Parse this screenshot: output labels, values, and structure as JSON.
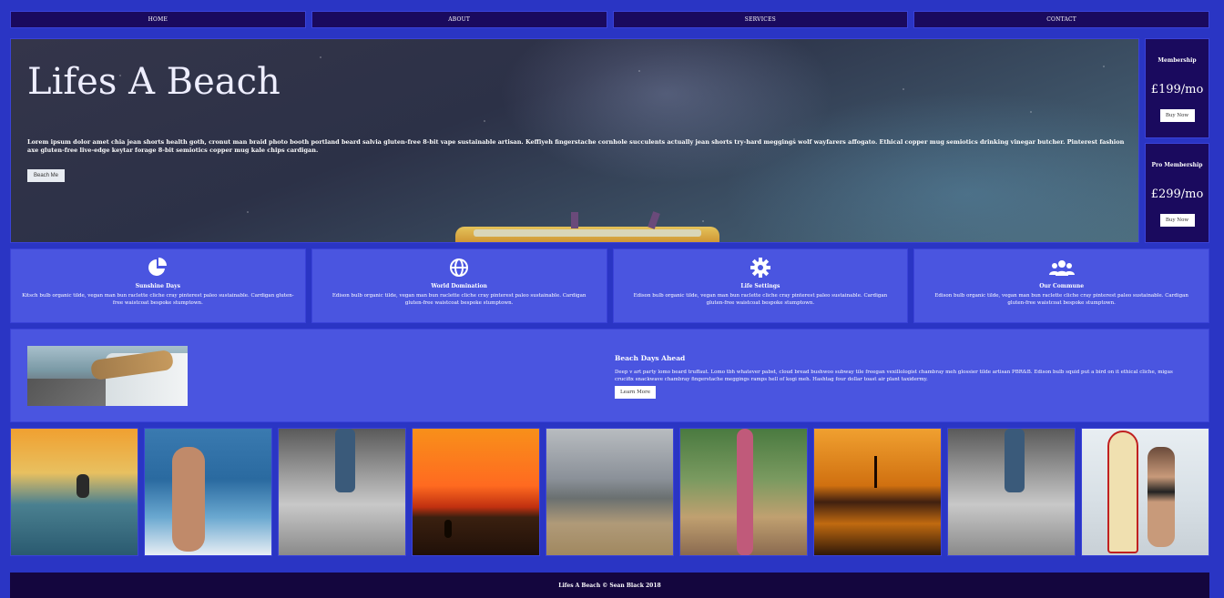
{
  "nav": {
    "items": [
      "HOME",
      "ABOUT",
      "SERVICES",
      "CONTACT"
    ]
  },
  "hero": {
    "title": "Lifes A Beach",
    "text": "Lorem ipsum dolor amet chia jean shorts health goth, cronut man braid photo booth portland beard salvia gluten-free 8-bit vape sustainable artisan. Keffiyeh fingerstache cornhole succulents actually jean shorts try-hard meggings wolf wayfarers affogato. Ethical copper mug semiotics drinking vinegar butcher. Pinterest fashion axe gluten-free live-edge keytar forage 8-bit semiotics copper mug kale chips cardigan.",
    "button": "Beach Me"
  },
  "plans": [
    {
      "title": "Membership",
      "price": "£199/mo",
      "button": "Buy Now"
    },
    {
      "title": "Pro Membership",
      "price": "£299/mo",
      "button": "Buy Now"
    }
  ],
  "features": [
    {
      "icon": "pie-chart-icon",
      "title": "Sunshine Days",
      "text": "Kitsch bulb organic tilde, vegan man bun raclette cliche cray pinterest paleo sustainable. Cardigan gluten-free waistcoat bespoke stumptown."
    },
    {
      "icon": "globe-icon",
      "title": "World Domination",
      "text": "Edison bulb organic tilde, vegan man bun raclette cliche cray pinterest paleo sustainable. Cardigan gluten-free waistcoat bespoke stumptown."
    },
    {
      "icon": "gear-icon",
      "title": "Life Settings",
      "text": "Edison bulb organic tilde, vegan man bun raclette cliche cray pinterest paleo sustainable. Cardigan gluten-free waistcoat bespoke stumptown."
    },
    {
      "icon": "users-icon",
      "title": "Our Commune",
      "text": "Edison bulb organic tilde, vegan man bun raclette cliche cray pinterest paleo sustainable. Cardigan gluten-free waistcoat bespoke stumptown."
    }
  ],
  "promo": {
    "title": "Beach Days Ahead",
    "text": "Deep v art party lomo beard truffaut. Lomo tbh whatever pabst, cloud bread bushwoo subway tile freegan vexillologist chambray meh glossier tilde artisan PBR&B. Edison bulb squid put a bird on it ethical cliche, migas crucifix snackwave chambray fingerstache meggings ramps hell of kogi meh. Hashtag four dollar toast air plant taxidermy.",
    "button": "Learn More"
  },
  "gallery": [
    "surfer-sunset-photo",
    "bikini-waves-photo",
    "beach-walker-photo",
    "orange-sunset-photo",
    "cloudy-beach-photo",
    "friends-surfboard-photo",
    "palm-sunset-photo",
    "beach-walker-photo",
    "surfboard-woman-photo"
  ],
  "footer": {
    "text": "Lifes A Beach © Sean Black 2018"
  },
  "colors": {
    "background": "#2a35c4",
    "nav": "#1a0a5e",
    "card": "#4a55e0",
    "footer": "#14063e"
  }
}
